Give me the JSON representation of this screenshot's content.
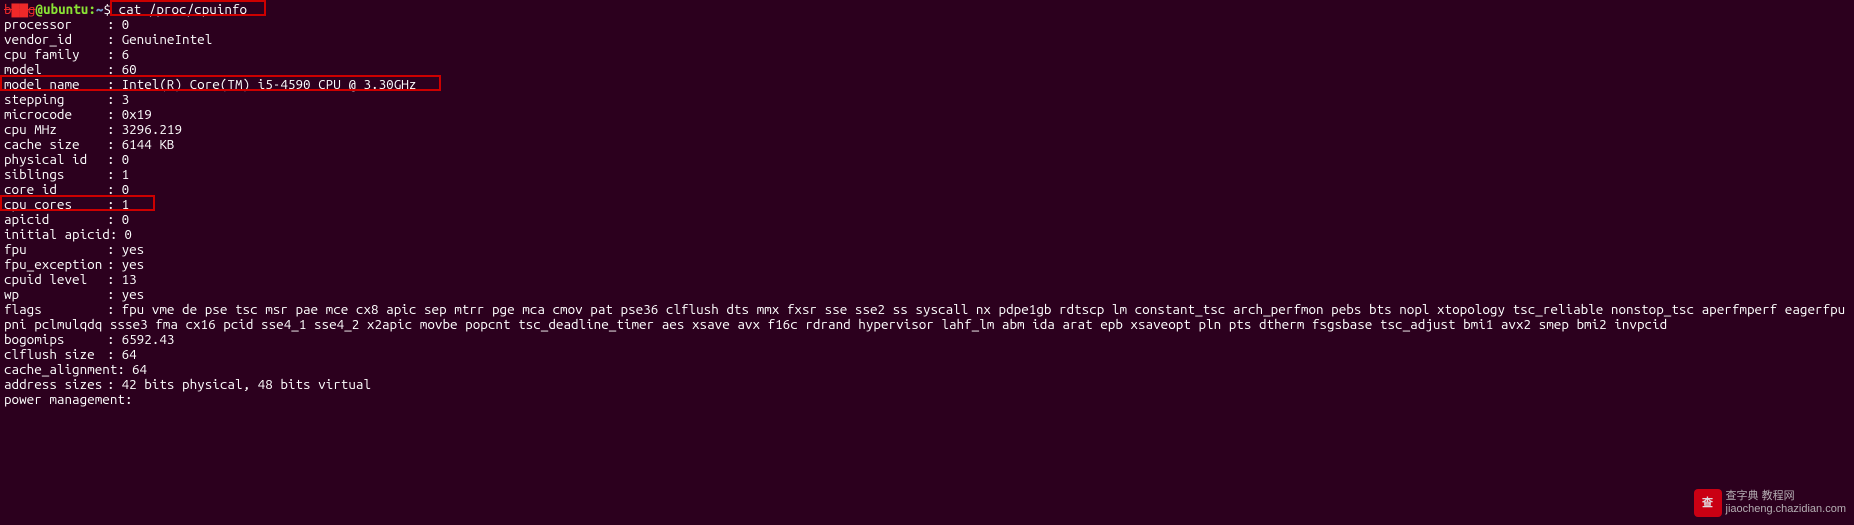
{
  "prompt": {
    "user_redacted": "b▇▇g",
    "at_host": "@ubuntu",
    "path": "~",
    "dollar": "$",
    "command": "cat /proc/cpuinfo"
  },
  "cpuinfo": {
    "processor": "0",
    "vendor_id": "GenuineIntel",
    "cpu_family": "6",
    "model": "60",
    "model_name": "Intel(R) Core(TM) i5-4590 CPU @ 3.30GHz",
    "stepping": "3",
    "microcode": "0x19",
    "cpu_mhz": "3296.219",
    "cache_size": "6144 KB",
    "physical_id": "0",
    "siblings": "1",
    "core_id": "0",
    "cpu_cores": "1",
    "apicid": "0",
    "initial_apicid": "0",
    "fpu": "yes",
    "fpu_exception": "yes",
    "cpuid_level": "13",
    "wp": "yes",
    "flags": "fpu vme de pse tsc msr pae mce cx8 apic sep mtrr pge mca cmov pat pse36 clflush dts mmx fxsr sse sse2 ss syscall nx pdpe1gb rdtscp lm constant_tsc arch_perfmon pebs bts nopl xtopology tsc_reliable nonstop_tsc aperfmperf eagerfpu pni pclmulqdq ssse3 fma cx16 pcid sse4_1 sse4_2 x2apic movbe popcnt tsc_deadline_timer aes xsave avx f16c rdrand hypervisor lahf_lm abm ida arat epb xsaveopt pln pts dtherm fsgsbase tsc_adjust bmi1 avx2 smep bmi2 invpcid",
    "bogomips": "6592.43",
    "clflush_size": "64",
    "cache_alignment": "64",
    "address_sizes": "42 bits physical, 48 bits virtual",
    "power_management": ""
  },
  "labels": {
    "processor": "processor",
    "vendor_id": "vendor_id",
    "cpu_family": "cpu family",
    "model": "model",
    "model_name": "model name",
    "stepping": "stepping",
    "microcode": "microcode",
    "cpu_mhz": "cpu MHz",
    "cache_size": "cache size",
    "physical_id": "physical id",
    "siblings": "siblings",
    "core_id": "core id",
    "cpu_cores": "cpu cores",
    "apicid": "apicid",
    "initial_apicid": "initial apicid",
    "fpu": "fpu",
    "fpu_exception": "fpu_exception",
    "cpuid_level": "cpuid level",
    "wp": "wp",
    "flags": "flags",
    "bogomips": "bogomips",
    "clflush_size": "clflush size",
    "cache_alignment": "cache_alignment",
    "address_sizes": "address sizes",
    "power_management": "power management"
  },
  "sep": ":",
  "watermark": {
    "logo": "查",
    "line1": "查字典 教程网",
    "line2": "jiaocheng.chazidian.com"
  }
}
